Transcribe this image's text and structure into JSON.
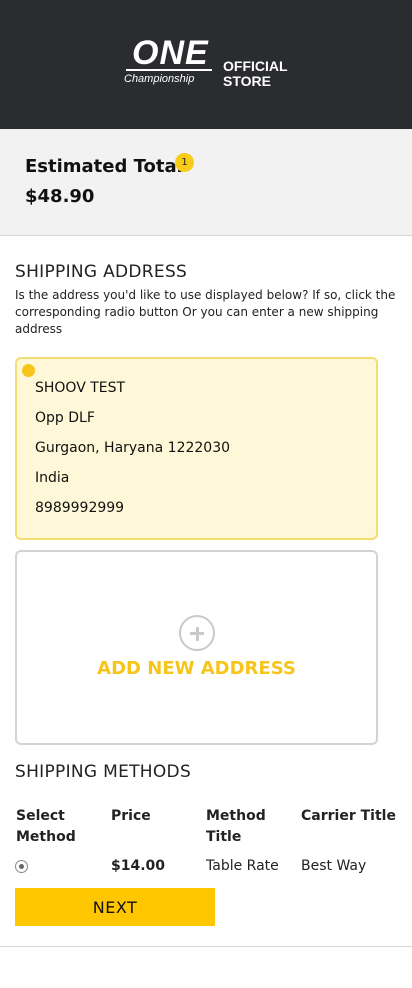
{
  "header": {
    "logo_main": "ONE",
    "logo_sub": "Championship",
    "store_line1": "OFFICIAL",
    "store_line2": "STORE"
  },
  "summary": {
    "label": "Estimated Total",
    "badge_count": "1",
    "total": "$48.90"
  },
  "shipping_address": {
    "title": "SHIPPING ADDRESS",
    "help_text": "Is the address you'd like to use displayed below? If so, click the corresponding radio button Or you can enter a new shipping address",
    "selected_address": {
      "name": "SHOOV TEST",
      "street": "Opp DLF",
      "city_line": "Gurgaon, Haryana 1222030",
      "country": "India",
      "phone": "8989992999"
    },
    "add_new_label": "ADD NEW ADDRESS"
  },
  "shipping_methods": {
    "title": "SHIPPING METHODS",
    "columns": [
      "Select Method",
      "Price",
      "Method Title",
      "Carrier Title"
    ],
    "rows": [
      {
        "selected": true,
        "price": "$14.00",
        "method_title": "Table Rate",
        "carrier_title": "Best Way"
      }
    ]
  },
  "actions": {
    "next_label": "NEXT"
  },
  "colors": {
    "header_bg": "#2b2c2f",
    "accent": "#ffc700",
    "address_card_bg": "#fff8d8"
  }
}
